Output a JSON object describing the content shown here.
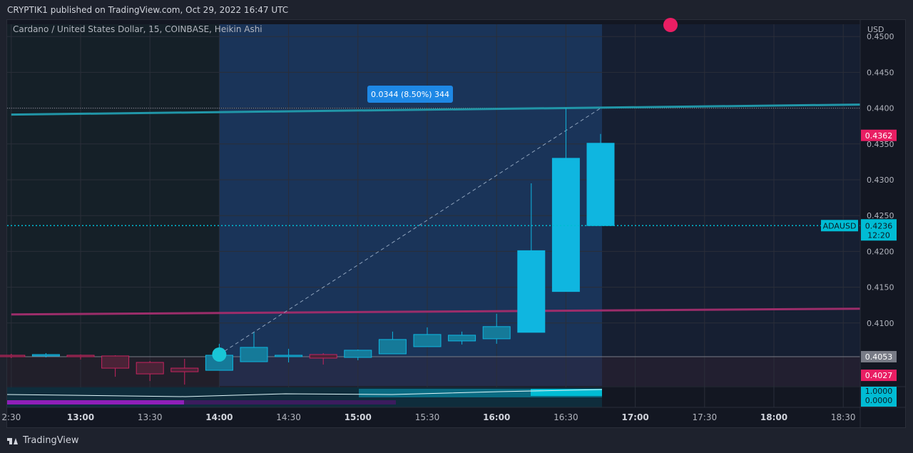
{
  "header": {
    "published_text": "CRYPTIK1 published on TradingView.com, Oct 29, 2022 16:47 UTC"
  },
  "chart_data": {
    "type": "candlestick",
    "title": "Cardano / United States Dollar, 15, COINBASE, Heikin Ashi",
    "currency_label": "USD",
    "y_ticks": [
      "0.4100",
      "0.4150",
      "0.4200",
      "0.4250",
      "0.4300",
      "0.4350",
      "0.4400",
      "0.4450",
      "0.4500"
    ],
    "x_ticks": [
      {
        "label": "2:30",
        "t": "12:30",
        "bold": false
      },
      {
        "label": "13:00",
        "t": "13:00",
        "bold": true
      },
      {
        "label": "13:30",
        "t": "13:30",
        "bold": false
      },
      {
        "label": "14:00",
        "t": "14:00",
        "bold": true
      },
      {
        "label": "14:30",
        "t": "14:30",
        "bold": false
      },
      {
        "label": "15:00",
        "t": "15:00",
        "bold": true
      },
      {
        "label": "15:30",
        "t": "15:30",
        "bold": false
      },
      {
        "label": "16:00",
        "t": "16:00",
        "bold": true
      },
      {
        "label": "16:30",
        "t": "16:30",
        "bold": false
      },
      {
        "label": "17:00",
        "t": "17:00",
        "bold": true
      },
      {
        "label": "17:30",
        "t": "17:30",
        "bold": false
      },
      {
        "label": "18:00",
        "t": "18:00",
        "bold": true
      },
      {
        "label": "18:30",
        "t": "18:30",
        "bold": false
      }
    ],
    "candles": [
      {
        "t": "12:30",
        "o": 0.4055,
        "h": 0.4057,
        "l": 0.4051,
        "c": 0.4053
      },
      {
        "t": "12:45",
        "o": 0.4054,
        "h": 0.4058,
        "l": 0.4052,
        "c": 0.4056
      },
      {
        "t": "13:00",
        "o": 0.4055,
        "h": 0.4056,
        "l": 0.4049,
        "c": 0.4053
      },
      {
        "t": "13:15",
        "o": 0.4054,
        "h": 0.4055,
        "l": 0.4025,
        "c": 0.4037
      },
      {
        "t": "13:30",
        "o": 0.4045,
        "h": 0.4047,
        "l": 0.4019,
        "c": 0.4029
      },
      {
        "t": "13:45",
        "o": 0.4037,
        "h": 0.405,
        "l": 0.4014,
        "c": 0.4032
      },
      {
        "t": "14:00",
        "o": 0.4034,
        "h": 0.4071,
        "l": 0.4034,
        "c": 0.4055
      },
      {
        "t": "14:15",
        "o": 0.4046,
        "h": 0.4087,
        "l": 0.4046,
        "c": 0.4066
      },
      {
        "t": "14:30",
        "o": 0.4054,
        "h": 0.4064,
        "l": 0.4045,
        "c": 0.4055
      },
      {
        "t": "14:45",
        "o": 0.4056,
        "h": 0.4058,
        "l": 0.4042,
        "c": 0.4051
      },
      {
        "t": "15:00",
        "o": 0.4052,
        "h": 0.4063,
        "l": 0.4048,
        "c": 0.4062
      },
      {
        "t": "15:15",
        "o": 0.4057,
        "h": 0.4088,
        "l": 0.4057,
        "c": 0.4077
      },
      {
        "t": "15:30",
        "o": 0.4067,
        "h": 0.4094,
        "l": 0.4067,
        "c": 0.4084
      },
      {
        "t": "15:45",
        "o": 0.4075,
        "h": 0.4088,
        "l": 0.407,
        "c": 0.4083
      },
      {
        "t": "16:00",
        "o": 0.4078,
        "h": 0.4113,
        "l": 0.4071,
        "c": 0.4095
      },
      {
        "t": "16:15",
        "o": 0.4087,
        "h": 0.4295,
        "l": 0.4087,
        "c": 0.4201
      },
      {
        "t": "16:30",
        "o": 0.4144,
        "h": 0.44,
        "l": 0.4144,
        "c": 0.433
      },
      {
        "t": "16:45",
        "o": 0.4236,
        "h": 0.4364,
        "l": 0.4236,
        "c": 0.4351
      }
    ],
    "trendlines": [
      {
        "name": "upper",
        "color": "#2196a8",
        "from": {
          "t": "12:30",
          "v": 0.4391
        },
        "to": {
          "t": "18:45",
          "v": 0.4405
        }
      },
      {
        "name": "lower",
        "color": "#9c2d6a",
        "from": {
          "t": "12:30",
          "v": 0.4112
        },
        "to": {
          "t": "18:45",
          "v": 0.412
        }
      }
    ],
    "measure": {
      "label": "0.0344 (8.50%) 344",
      "from": {
        "t": "14:00",
        "v": 0.4056
      },
      "to": {
        "t": "16:45",
        "v": 0.44
      }
    },
    "price_line": {
      "v": 0.4236,
      "symbol": "ADAUSD",
      "price": "0.4236",
      "countdown": "12:20",
      "color": "#00bcd4"
    },
    "price_badges": [
      {
        "v": 0.4362,
        "label": "0.4362",
        "color": "#e91e63"
      },
      {
        "v": 0.4053,
        "label": "0.4053",
        "color": "#787b86"
      },
      {
        "v": 0.4027,
        "label": "0.4027",
        "color": "#e91e63"
      }
    ],
    "indicator": {
      "labels": [
        "1.0000",
        "0.0000"
      ],
      "color": "#00bcd4"
    },
    "colors": {
      "up": "#0fb6e0",
      "down": "#c7245f",
      "wick_up": "#0fb6e0",
      "wick_down": "#c7245f"
    }
  },
  "footer": {
    "brand": "TradingView"
  }
}
